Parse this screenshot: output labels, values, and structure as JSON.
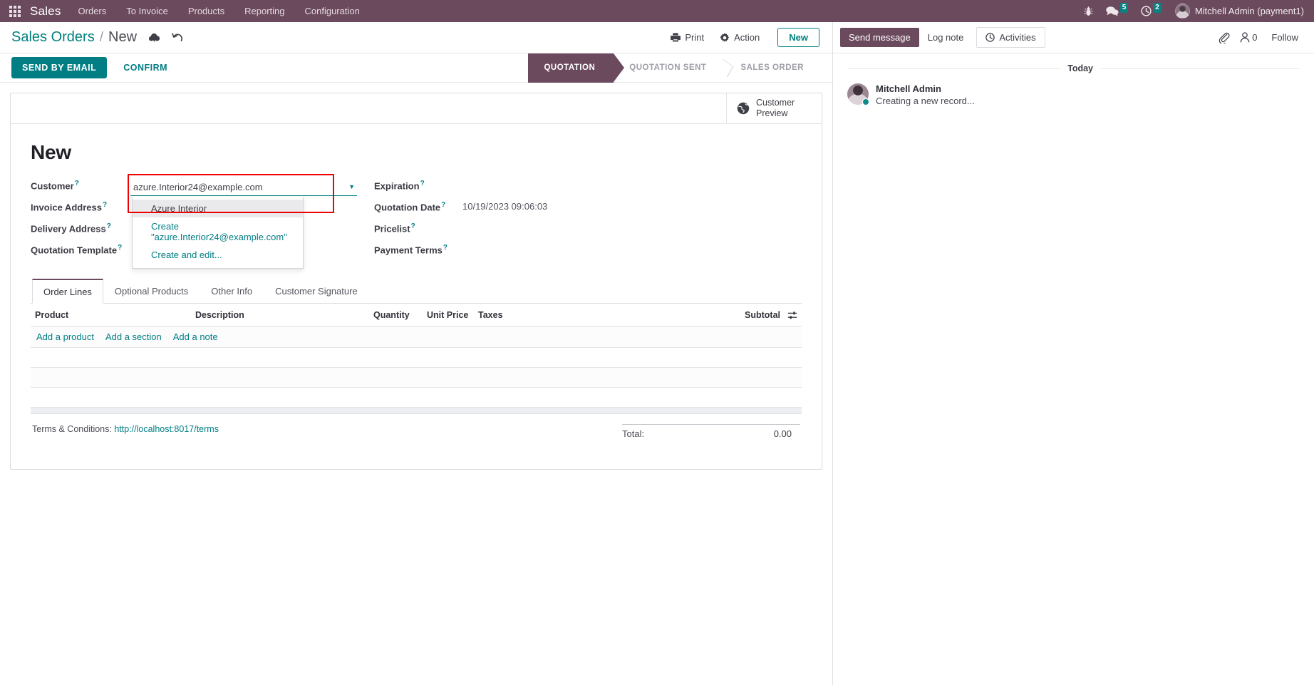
{
  "navbar": {
    "apps_icon": "apps-grid-icon",
    "brand": "Sales",
    "menus": [
      "Orders",
      "To Invoice",
      "Products",
      "Reporting",
      "Configuration"
    ],
    "bug_icon": "bug-icon",
    "messages_icon": "chat-bubble-icon",
    "messages_count": "5",
    "activities_icon": "clock-icon",
    "activities_count": "2",
    "user_name": "Mitchell Admin (payment1)",
    "avatar_icon": "user-avatar"
  },
  "control_panel": {
    "breadcrumb_parent": "Sales Orders",
    "breadcrumb_separator": "/",
    "breadcrumb_current": "New",
    "save_icon": "cloud-upload-icon",
    "discard_icon": "undo-icon",
    "print_label": "Print",
    "print_icon": "printer-icon",
    "action_label": "Action",
    "action_icon": "gear-icon",
    "new_label": "New"
  },
  "statusbar": {
    "send_by_email": "SEND BY EMAIL",
    "confirm": "CONFIRM",
    "stages": [
      {
        "label": "QUOTATION",
        "state": "active"
      },
      {
        "label": "QUOTATION SENT",
        "state": "todo"
      },
      {
        "label": "SALES ORDER",
        "state": "todo"
      }
    ]
  },
  "sheet": {
    "stat_button": {
      "icon": "globe-icon",
      "line1": "Customer",
      "line2": "Preview"
    },
    "record_title": "New",
    "left_fields": [
      {
        "label": "Customer",
        "help": "?",
        "value": ""
      },
      {
        "label": "Invoice Address",
        "help": "?",
        "value": ""
      },
      {
        "label": "Delivery Address",
        "help": "?",
        "value": ""
      },
      {
        "label": "Quotation Template",
        "help": "?",
        "value": ""
      }
    ],
    "right_fields": [
      {
        "label": "Expiration",
        "help": "?",
        "value": ""
      },
      {
        "label": "Quotation Date",
        "help": "?",
        "value": "10/19/2023 09:06:03"
      },
      {
        "label": "Pricelist",
        "help": "?",
        "value": ""
      },
      {
        "label": "Payment Terms",
        "help": "?",
        "value": ""
      }
    ],
    "customer_autocomplete": {
      "input_value": "azure.Interior24@example.com",
      "input_placeholder": "",
      "caret_icon": "chevron-down-icon",
      "options": [
        {
          "label": "Azure Interior",
          "kind": "record",
          "highlighted": true
        },
        {
          "label": "Create \"azure.Interior24@example.com\"",
          "kind": "create",
          "highlighted": false
        },
        {
          "label": "Create and edit...",
          "kind": "create",
          "highlighted": false
        }
      ]
    }
  },
  "notebook": {
    "tabs": [
      {
        "label": "Order Lines",
        "active": true
      },
      {
        "label": "Optional Products",
        "active": false
      },
      {
        "label": "Other Info",
        "active": false
      },
      {
        "label": "Customer Signature",
        "active": false
      }
    ],
    "columns": [
      "Product",
      "Description",
      "Quantity",
      "Unit Price",
      "Taxes",
      "Subtotal"
    ],
    "column_options_icon": "sliders-icon",
    "rows": [],
    "add_links": [
      "Add a product",
      "Add a section",
      "Add a note"
    ],
    "terms_label": "Terms & Conditions:",
    "terms_url": "http://localhost:8017/terms",
    "total_label": "Total:",
    "total_value": "0.00"
  },
  "chatter": {
    "send_message": "Send message",
    "log_note": "Log note",
    "activities": "Activities",
    "activities_icon": "clock-icon",
    "attachment_icon": "paperclip-icon",
    "followers_icon": "user-icon",
    "followers_count": "0",
    "follow_label": "Follow",
    "day_separator": "Today",
    "messages": [
      {
        "author": "Mitchell Admin",
        "body": "Creating a new record...",
        "avatar": "user-avatar",
        "online": true
      }
    ]
  },
  "colors": {
    "brand_purple": "#6b4a5e",
    "accent_teal": "#017e84",
    "annotation_red": "#f00000",
    "badge_teal": "#0e7f7f"
  }
}
